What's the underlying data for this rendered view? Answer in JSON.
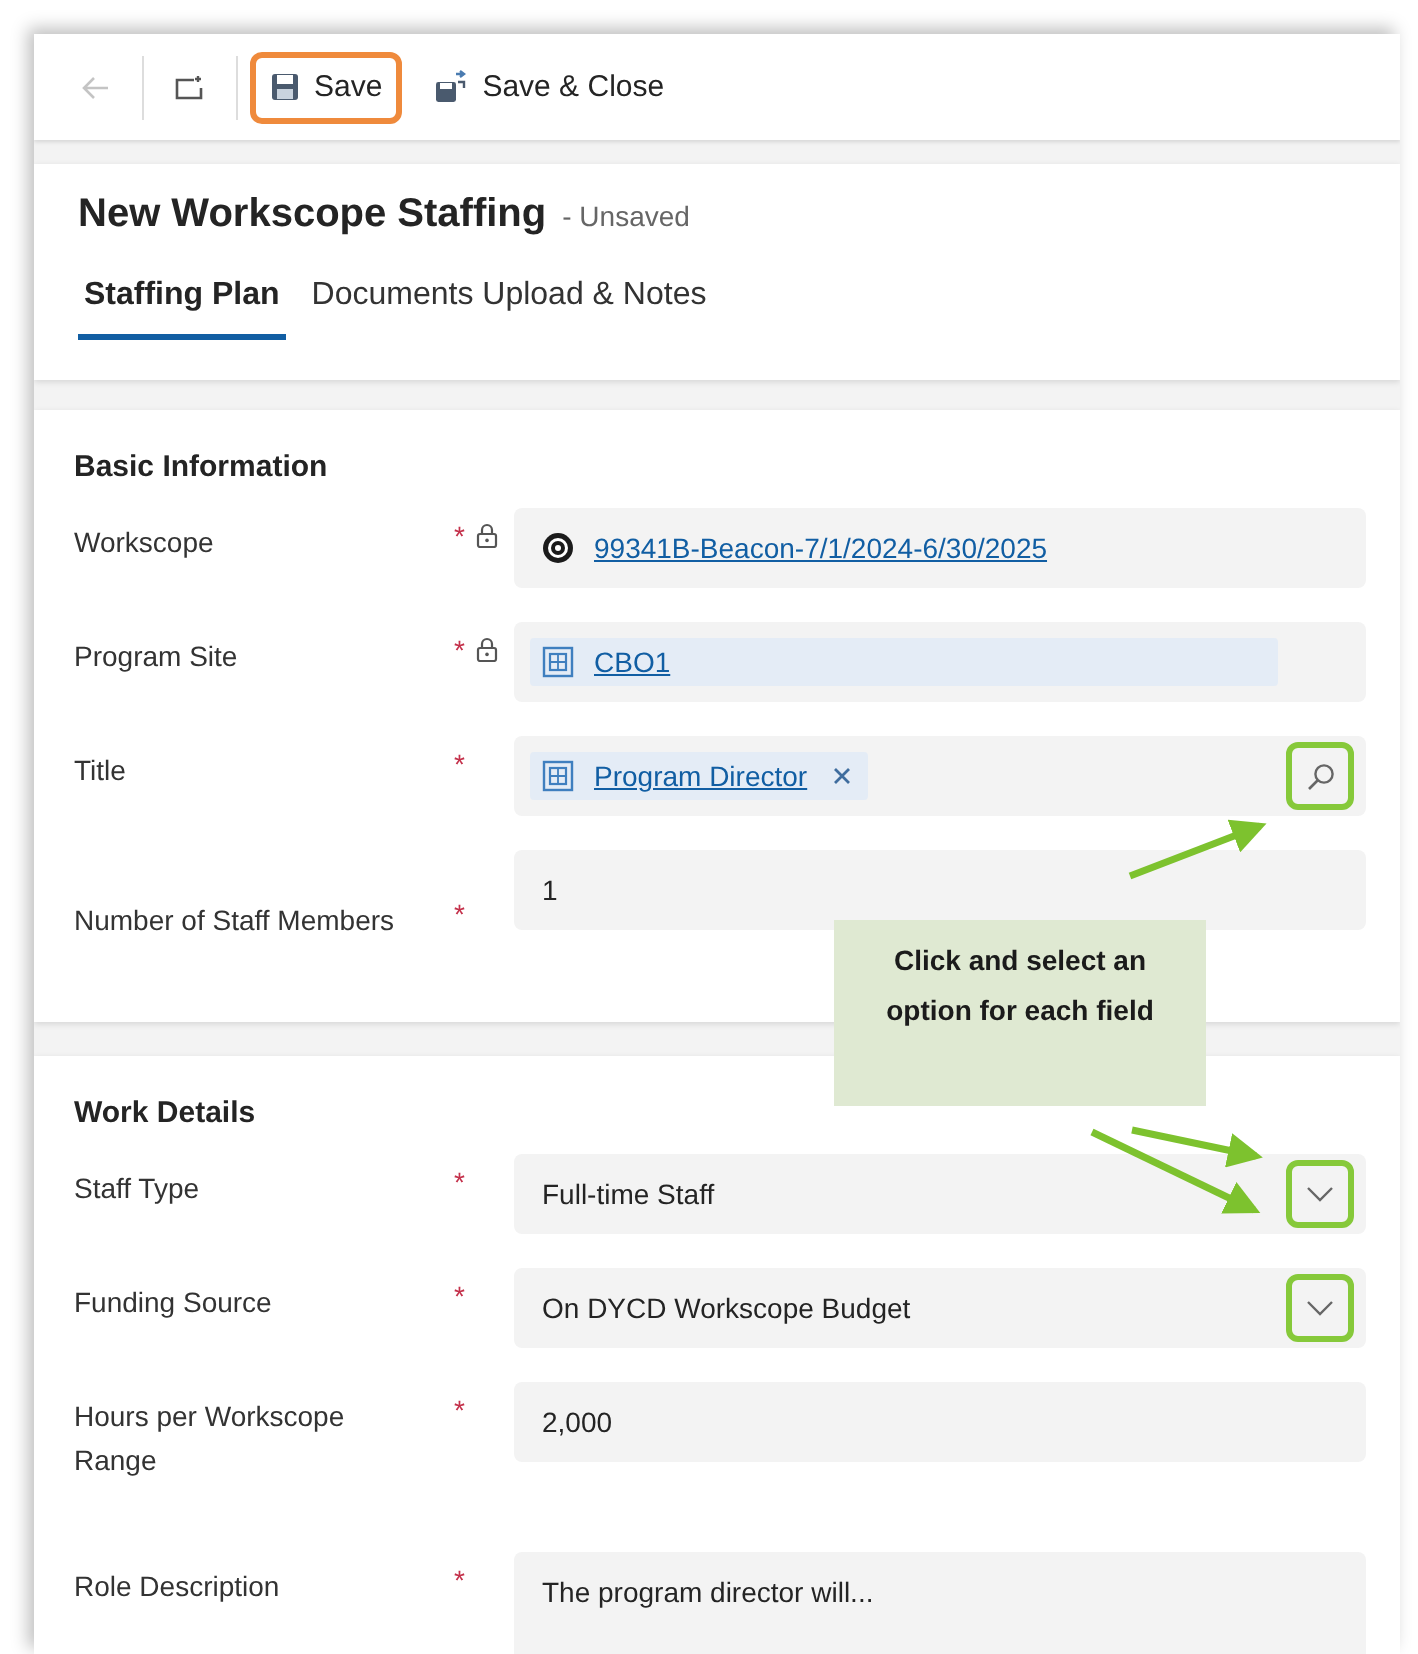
{
  "toolbar": {
    "buttons": [
      {
        "kind": "back",
        "disabled": true
      },
      {
        "kind": "popout",
        "disabled": false
      },
      {
        "kind": "save",
        "label": "Save",
        "highlighted": true
      },
      {
        "kind": "save_close",
        "label": "Save & Close",
        "highlighted": false
      }
    ]
  },
  "header": {
    "title": "New Workscope Staffing",
    "status": "- Unsaved"
  },
  "tabs": [
    {
      "label": "Staffing Plan",
      "selected": true
    },
    {
      "label": "Documents Upload & Notes",
      "selected": false
    }
  ],
  "sections": [
    {
      "title": "Basic Information",
      "fields": [
        {
          "label": "Workscope",
          "required": "*",
          "locked": true,
          "kind": "reference",
          "value": "99341B-Beacon-7/1/2024-6/30/2025"
        },
        {
          "label": "Program Site",
          "required": "*",
          "locked": true,
          "kind": "lookup",
          "value": "CBO1"
        },
        {
          "label": "Title",
          "required": "*",
          "locked": false,
          "kind": "lookup",
          "value": "Program Director",
          "removable": true,
          "highlighted": true
        },
        {
          "label": "Number of Staff Members",
          "required": "*",
          "locked": false,
          "kind": "text",
          "value": "1"
        }
      ]
    },
    {
      "title": "Work Details",
      "fields": [
        {
          "label": "Staff Type",
          "required": "*",
          "locked": false,
          "kind": "select",
          "value": "Full-time Staff",
          "highlighted": true
        },
        {
          "label": "Funding Source",
          "required": "*",
          "locked": false,
          "kind": "select",
          "value": "On DYCD Workscope Budget",
          "highlighted": true
        },
        {
          "label": "Hours per Workscope Range",
          "required": "*",
          "locked": false,
          "kind": "text",
          "value": "2,000"
        },
        {
          "label": "Role Description",
          "required": "*",
          "locked": false,
          "kind": "textarea",
          "value": "The program director will..."
        }
      ]
    }
  ],
  "callout": {
    "text": "Click and select an option for each field"
  }
}
